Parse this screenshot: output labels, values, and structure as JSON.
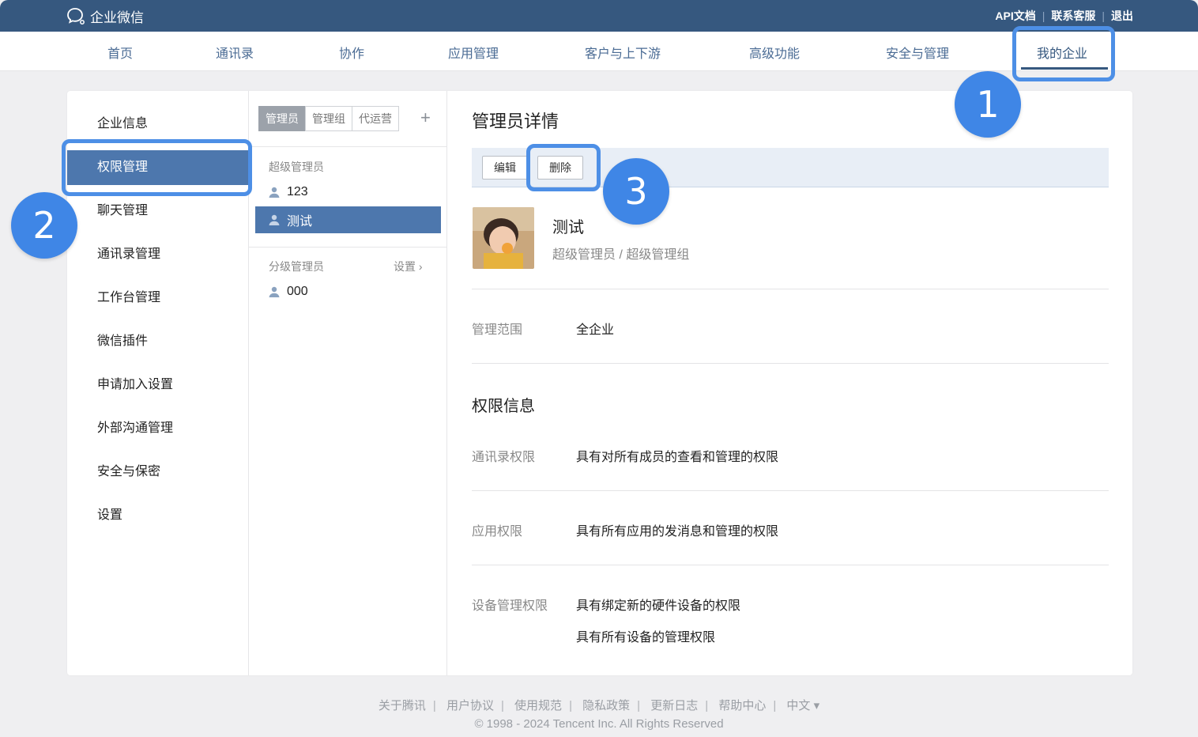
{
  "app": {
    "logo_text": "企业微信"
  },
  "top_links": [
    "API文档",
    "联系客服",
    "退出"
  ],
  "nav": [
    "首页",
    "通讯录",
    "协作",
    "应用管理",
    "客户与上下游",
    "高级功能",
    "安全与管理",
    "我的企业"
  ],
  "nav_active": "我的企业",
  "sidebar": [
    "企业信息",
    "权限管理",
    "聊天管理",
    "通讯录管理",
    "工作台管理",
    "微信插件",
    "申请加入设置",
    "外部沟通管理",
    "安全与保密",
    "设置"
  ],
  "sidebar_active": "权限管理",
  "mid": {
    "tabs": [
      "管理员",
      "管理组",
      "代运营"
    ],
    "add_symbol": "+",
    "super_admin_title": "超级管理员",
    "super_admins": [
      "123",
      "测试"
    ],
    "selected_admin": "测试",
    "sub_admin_title": "分级管理员",
    "sub_admin_action": "设置",
    "sub_admins": [
      "000"
    ]
  },
  "detail": {
    "title": "管理员详情",
    "edit_label": "编辑",
    "delete_label": "删除",
    "name": "测试",
    "role": "超级管理员 / 超级管理组",
    "scope_label": "管理范围",
    "scope_value": "全企业",
    "perm_title": "权限信息",
    "contacts_perm_label": "通讯录权限",
    "contacts_perm_value": "具有对所有成员的查看和管理的权限",
    "app_perm_label": "应用权限",
    "app_perm_value": "具有所有应用的发消息和管理的权限",
    "device_perm_label": "设备管理权限",
    "device_perm_values": [
      "具有绑定新的硬件设备的权限",
      "具有所有设备的管理权限"
    ]
  },
  "callouts": [
    "1",
    "2",
    "3"
  ],
  "footer": {
    "links": [
      "关于腾讯",
      "用户协议",
      "使用规范",
      "隐私政策",
      "更新日志",
      "帮助中心",
      "中文 ▾"
    ],
    "copyright": "© 1998 - 2024 Tencent Inc. All Rights Reserved"
  },
  "colors": {
    "header": "#36587f",
    "accent": "#4d77ad",
    "callout": "#3f86e6"
  }
}
